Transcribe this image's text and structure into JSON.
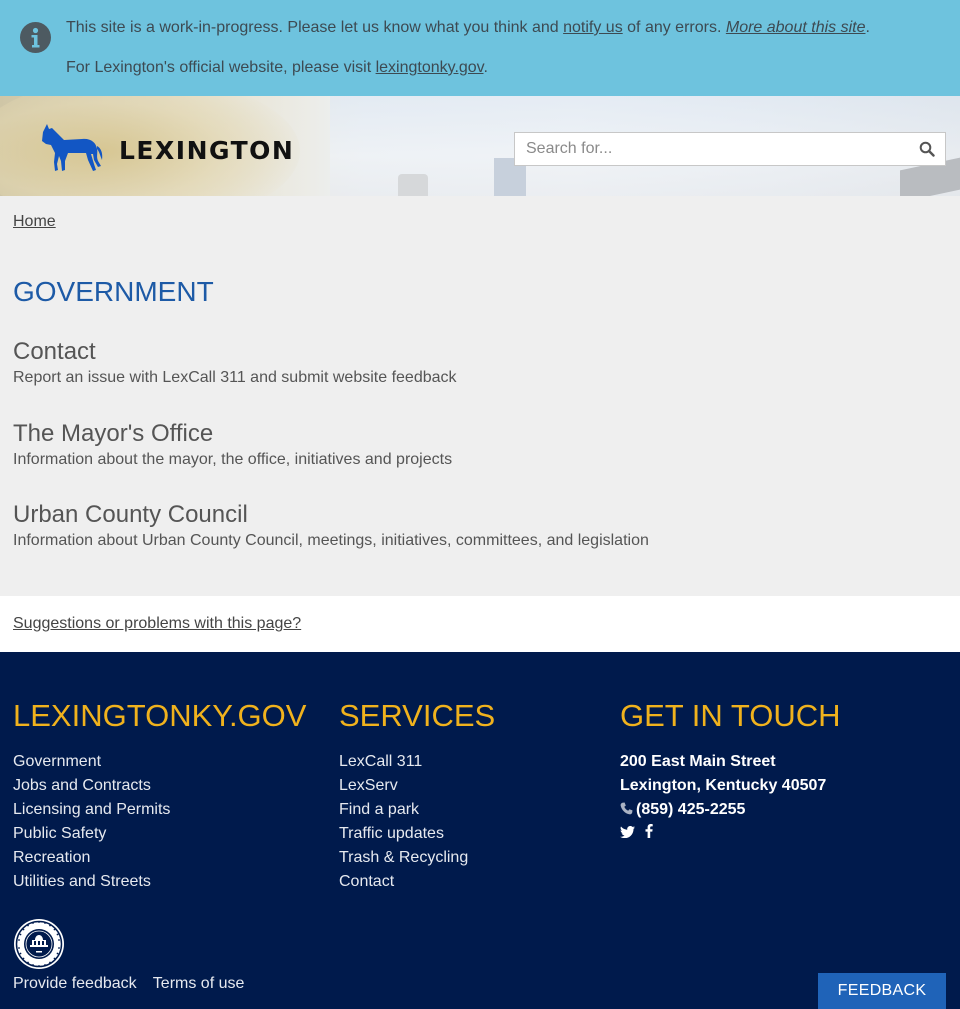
{
  "alert": {
    "text_before": "This site is a work-in-progress. Please let us know what you think and ",
    "notify_link": "notify us",
    "text_middle": " of any errors. ",
    "more_link": "More about this site",
    "text_end": ".",
    "official_text": "For Lexington's official website, please visit ",
    "official_link": "lexingtonky.gov",
    "official_end": ".",
    "color": "#6ec3de"
  },
  "header": {
    "logo_text": "LEXINGTON",
    "search_placeholder": "Search for...",
    "logo_color": "#1256c4"
  },
  "breadcrumb": {
    "home": "Home"
  },
  "page": {
    "title": "GOVERNMENT",
    "items": [
      {
        "title": "Contact",
        "description": "Report an issue with LexCall 311 and submit website feedback"
      },
      {
        "title": "The Mayor's Office",
        "description": "Information about the mayor, the office, initiatives and projects"
      },
      {
        "title": "Urban County Council",
        "description": "Information about Urban County Council, meetings, initiatives, committees, and legislation"
      }
    ],
    "suggest_link": "Suggestions or problems with this page?"
  },
  "footer": {
    "col1": {
      "title": "LEXINGTONKY.GOV",
      "links": [
        "Government",
        "Jobs and Contracts",
        "Licensing and Permits",
        "Public Safety",
        "Recreation",
        "Utilities and Streets"
      ]
    },
    "col2": {
      "title": "SERVICES",
      "links": [
        "LexCall 311",
        "LexServ",
        "Find a park",
        "Traffic updates",
        "Trash & Recycling",
        "Contact"
      ]
    },
    "col3": {
      "title": "GET IN TOUCH",
      "address1": "200 East Main Street",
      "address2": "Lexington, Kentucky 40507",
      "phone": "(859) 425-2255",
      "social": [
        "twitter-icon",
        "facebook-icon"
      ]
    },
    "seal_text": "LEXINGTON-FAYETTE URBAN COUNTY GOVERNMENT",
    "seal_year": "1775",
    "provide_feedback": "Provide feedback",
    "terms": "Terms of use",
    "feedback_button": "FEEDBACK",
    "accent_color": "#f0b21d",
    "background_color": "#001a4c"
  }
}
